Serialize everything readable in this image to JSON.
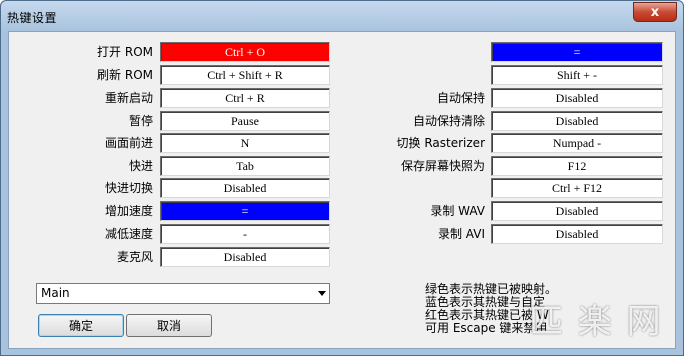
{
  "window": {
    "title": "热键设置",
    "close_glyph": "x"
  },
  "left": [
    {
      "label": "打开 ROM",
      "value": "Ctrl + O",
      "color": "#ff0000"
    },
    {
      "label": "刷新 ROM",
      "value": "Ctrl + Shift + R"
    },
    {
      "label": "重新启动",
      "value": "Ctrl + R"
    },
    {
      "label": "暂停",
      "value": "Pause"
    },
    {
      "label": "画面前进",
      "value": "N"
    },
    {
      "label": "快进",
      "value": "Tab"
    },
    {
      "label": "快进切换",
      "value": "Disabled"
    },
    {
      "label": "增加速度",
      "value": "=",
      "color": "#0000ff"
    },
    {
      "label": "减低速度",
      "value": "-"
    },
    {
      "label": "麦克风",
      "value": "Disabled"
    }
  ],
  "right": [
    {
      "label": "",
      "value": "=",
      "color": "#0000ff"
    },
    {
      "label": "",
      "value": "Shift + -"
    },
    {
      "label": "自动保持",
      "value": "Disabled"
    },
    {
      "label": "自动保持清除",
      "value": "Disabled"
    },
    {
      "label": "切换 Rasterizer",
      "value": "Numpad -"
    },
    {
      "label": "保存屏幕快照为",
      "value": "F12"
    },
    {
      "label": "",
      "value": "Ctrl + F12"
    },
    {
      "label": "录制 WAV",
      "value": "Disabled"
    },
    {
      "label": "录制 AVI",
      "value": "Disabled"
    }
  ],
  "profile_select": {
    "value": "Main"
  },
  "buttons": {
    "ok": "确定",
    "cancel": "取消"
  },
  "legend": [
    "绿色表示热键已被映射。",
    "蓝色表示其热键与自定",
    "红色表示其热键已被 W",
    "可用 Escape 键来禁用"
  ],
  "watermark": "匹 楽 网"
}
